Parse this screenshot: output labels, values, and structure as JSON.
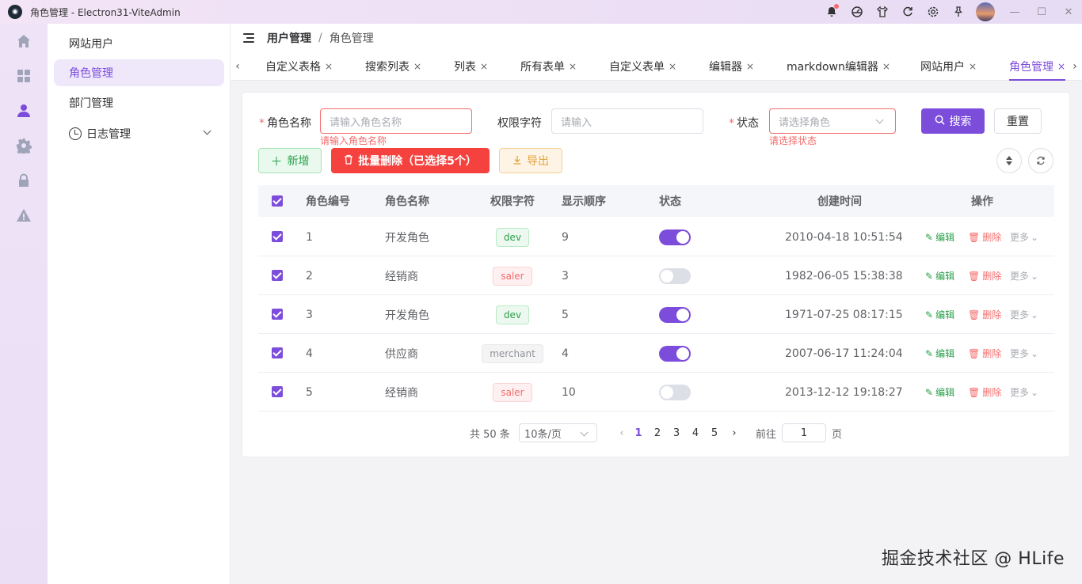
{
  "window": {
    "title": "角色管理 - Electron31-ViteAdmin",
    "logo": "logo-icon"
  },
  "titlebar_icons": [
    "bell-icon",
    "dashboard-icon",
    "shirt-icon",
    "refresh-icon",
    "settings-icon",
    "pin-icon"
  ],
  "rail": {
    "items": [
      "home-icon",
      "grid-icon",
      "user-icon",
      "gear-icon",
      "lock-icon",
      "warning-icon"
    ],
    "active": "user-icon"
  },
  "submenu": {
    "items": [
      "网站用户",
      "角色管理",
      "部门管理",
      "日志管理"
    ],
    "active": "角色管理"
  },
  "breadcrumb": {
    "parent": "用户管理",
    "separator": "/",
    "current": "角色管理"
  },
  "tabs": [
    {
      "label": "自定义表格"
    },
    {
      "label": "搜索列表"
    },
    {
      "label": "列表"
    },
    {
      "label": "所有表单"
    },
    {
      "label": "自定义表单"
    },
    {
      "label": "编辑器"
    },
    {
      "label": "markdown编辑器"
    },
    {
      "label": "网站用户"
    },
    {
      "label": "角色管理",
      "active": true
    }
  ],
  "tab_close": "×",
  "tab_prev": "‹",
  "tab_next": "›",
  "search_form": {
    "role_name": {
      "label": "角色名称",
      "required": "*",
      "placeholder": "请输入角色名称",
      "error": "请输入角色名称"
    },
    "permission": {
      "label": "权限字符",
      "placeholder": "请输入"
    },
    "status": {
      "label": "状态",
      "required": "*",
      "placeholder": "请选择角色",
      "error": "请选择状态"
    },
    "search_button": "搜索",
    "reset_button": "重置"
  },
  "toolbar": {
    "add_button": "新增",
    "batch_delete_button": "批量删除（已选择5个）",
    "export_button": "导出"
  },
  "table": {
    "columns": [
      "角色编号",
      "角色名称",
      "权限字符",
      "显示顺序",
      "状态",
      "创建时间",
      "操作"
    ],
    "rows": [
      {
        "id": "1",
        "name": "开发角色",
        "perm": "dev",
        "order": "9",
        "status": true,
        "created": "2010-04-18 10:51:54"
      },
      {
        "id": "2",
        "name": "经销商",
        "perm": "saler",
        "order": "3",
        "status": false,
        "created": "1982-06-05 15:38:38"
      },
      {
        "id": "3",
        "name": "开发角色",
        "perm": "dev",
        "order": "5",
        "status": true,
        "created": "1971-07-25 08:17:15"
      },
      {
        "id": "4",
        "name": "供应商",
        "perm": "merchant",
        "order": "4",
        "status": true,
        "created": "2007-06-17 11:24:04"
      },
      {
        "id": "5",
        "name": "经销商",
        "perm": "saler",
        "order": "10",
        "status": false,
        "created": "2013-12-12 19:18:27"
      }
    ],
    "actions": {
      "edit": "编辑",
      "delete": "删除",
      "more": "更多"
    }
  },
  "pagination": {
    "total": "共 50 条",
    "page_size": "10条/页",
    "pages": [
      "1",
      "2",
      "3",
      "4",
      "5"
    ],
    "current": "1",
    "goto_label": "前往",
    "goto_value": "1",
    "page_unit": "页"
  },
  "watermark": "掘金技术社区 @ HLife",
  "colors": {
    "accent": "#7c4ddb",
    "danger": "#f56c6c",
    "success": "#2aa04b",
    "warning": "#e6a23c"
  }
}
